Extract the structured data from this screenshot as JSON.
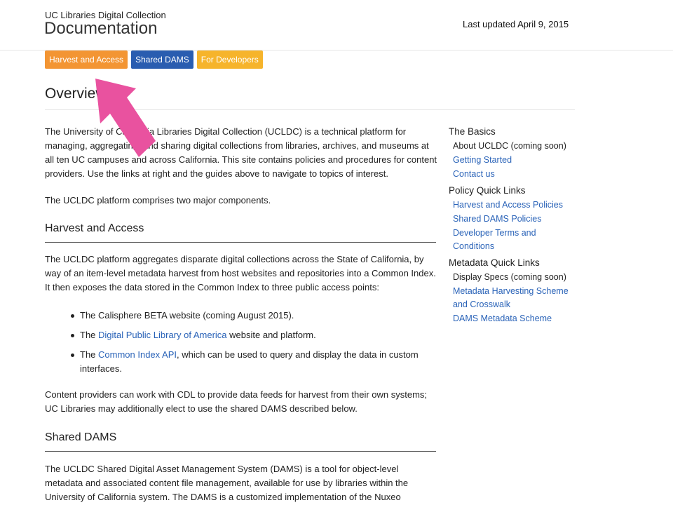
{
  "header": {
    "site_name": "UC Libraries Digital Collection",
    "title": "Documentation",
    "last_updated": "Last updated April 9, 2015"
  },
  "tabs": [
    {
      "label": "Harvest and Access",
      "color": "#f39533"
    },
    {
      "label": "Shared DAMS",
      "color": "#2a5db0"
    },
    {
      "label": "For Developers",
      "color": "#f6b42b"
    }
  ],
  "main": {
    "heading": "Overview",
    "intro": "The University of California Libraries Digital Collection (UCLDC) is a technical platform for managing, aggregating, and sharing digital collections from libraries, archives, and museums at all ten UC campuses and across California. This site contains policies and procedures for content providers. Use the links at right and the guides above to navigate to topics of interest.",
    "components": "The UCLDC platform comprises two major components.",
    "harvest_heading": "Harvest and Access",
    "harvest_text": "The UCLDC platform aggregates disparate digital collections across the State of California, by way of an item-level metadata harvest from host websites and repositories into a Common Index. It then exposes the data stored in the Common Index to three public access points:",
    "bullets": [
      {
        "pre": "The Calisphere BETA website (coming August 2015).",
        "link": "",
        "post": ""
      },
      {
        "pre": "The ",
        "link": "Digital Public Library of America",
        "post": " website and platform."
      },
      {
        "pre": "The ",
        "link": "Common Index API",
        "post": ", which can be used to query and display the data in custom interfaces."
      }
    ],
    "providers_text": "Content providers can work with CDL to provide data feeds for harvest from their own systems; UC Libraries may additionally elect to use the shared DAMS described below.",
    "dams_heading": "Shared DAMS",
    "dams_text": "The UCLDC Shared Digital Asset Management System (DAMS) is a tool for object-level metadata and associated content file management, available for use by libraries within the University of California system. The DAMS is a customized implementation of the Nuxeo"
  },
  "sidebar": {
    "sections": [
      {
        "heading": "The Basics",
        "items": [
          {
            "label": "About UCLDC (coming soon)",
            "link": false
          },
          {
            "label": "Getting Started",
            "link": true
          },
          {
            "label": "Contact us",
            "link": true
          }
        ]
      },
      {
        "heading": "Policy Quick Links",
        "items": [
          {
            "label": "Harvest and Access Policies",
            "link": true
          },
          {
            "label": "Shared DAMS Policies",
            "link": true
          },
          {
            "label": "Developer Terms and Conditions",
            "link": true
          }
        ]
      },
      {
        "heading": "Metadata Quick Links",
        "items": [
          {
            "label": "Display Specs (coming soon)",
            "link": false
          },
          {
            "label": "Metadata Harvesting Scheme and Crosswalk",
            "link": true
          },
          {
            "label": "DAMS Metadata Scheme",
            "link": true
          }
        ]
      }
    ]
  },
  "annotation": {
    "arrow_color": "#e9529f"
  }
}
